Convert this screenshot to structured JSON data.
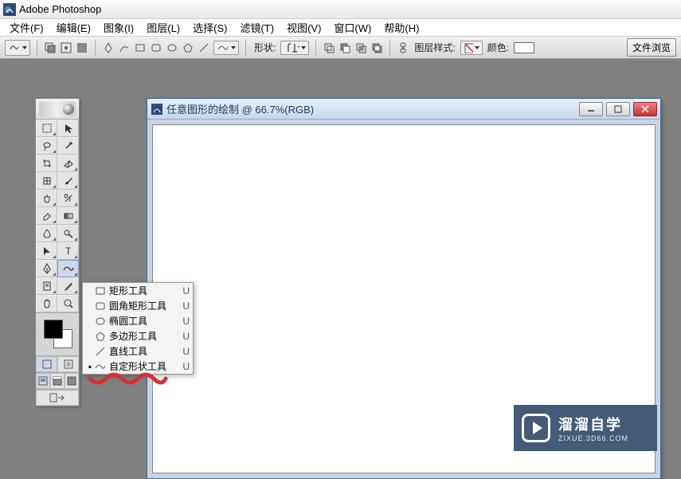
{
  "app": {
    "title": "Adobe Photoshop"
  },
  "menu": {
    "file": "文件(F)",
    "edit": "编辑(E)",
    "image": "图象(I)",
    "layer": "图层(L)",
    "select": "选择(S)",
    "filter": "滤镜(T)",
    "view": "视图(V)",
    "window": "窗口(W)",
    "help": "帮助(H)"
  },
  "options": {
    "shape_label": "形状:",
    "layer_style_label": "图层样式:",
    "color_label": "颜色:",
    "file_browse": "文件浏览"
  },
  "doc": {
    "title": "任意图形的绘制 @ 66.7%(RGB)"
  },
  "flyout": {
    "items": [
      {
        "label": "矩形工具",
        "key": "U",
        "icon": "rectangle",
        "checked": false
      },
      {
        "label": "圆角矩形工具",
        "key": "U",
        "icon": "rounded-rect",
        "checked": false
      },
      {
        "label": "椭圆工具",
        "key": "U",
        "icon": "ellipse",
        "checked": false
      },
      {
        "label": "多边形工具",
        "key": "U",
        "icon": "polygon",
        "checked": false
      },
      {
        "label": "直线工具",
        "key": "U",
        "icon": "line",
        "checked": false
      },
      {
        "label": "自定形状工具",
        "key": "U",
        "icon": "custom-shape",
        "checked": true
      }
    ]
  },
  "watermark": {
    "main": "溜溜自学",
    "sub": "ZIXUE.3D66.COM"
  }
}
